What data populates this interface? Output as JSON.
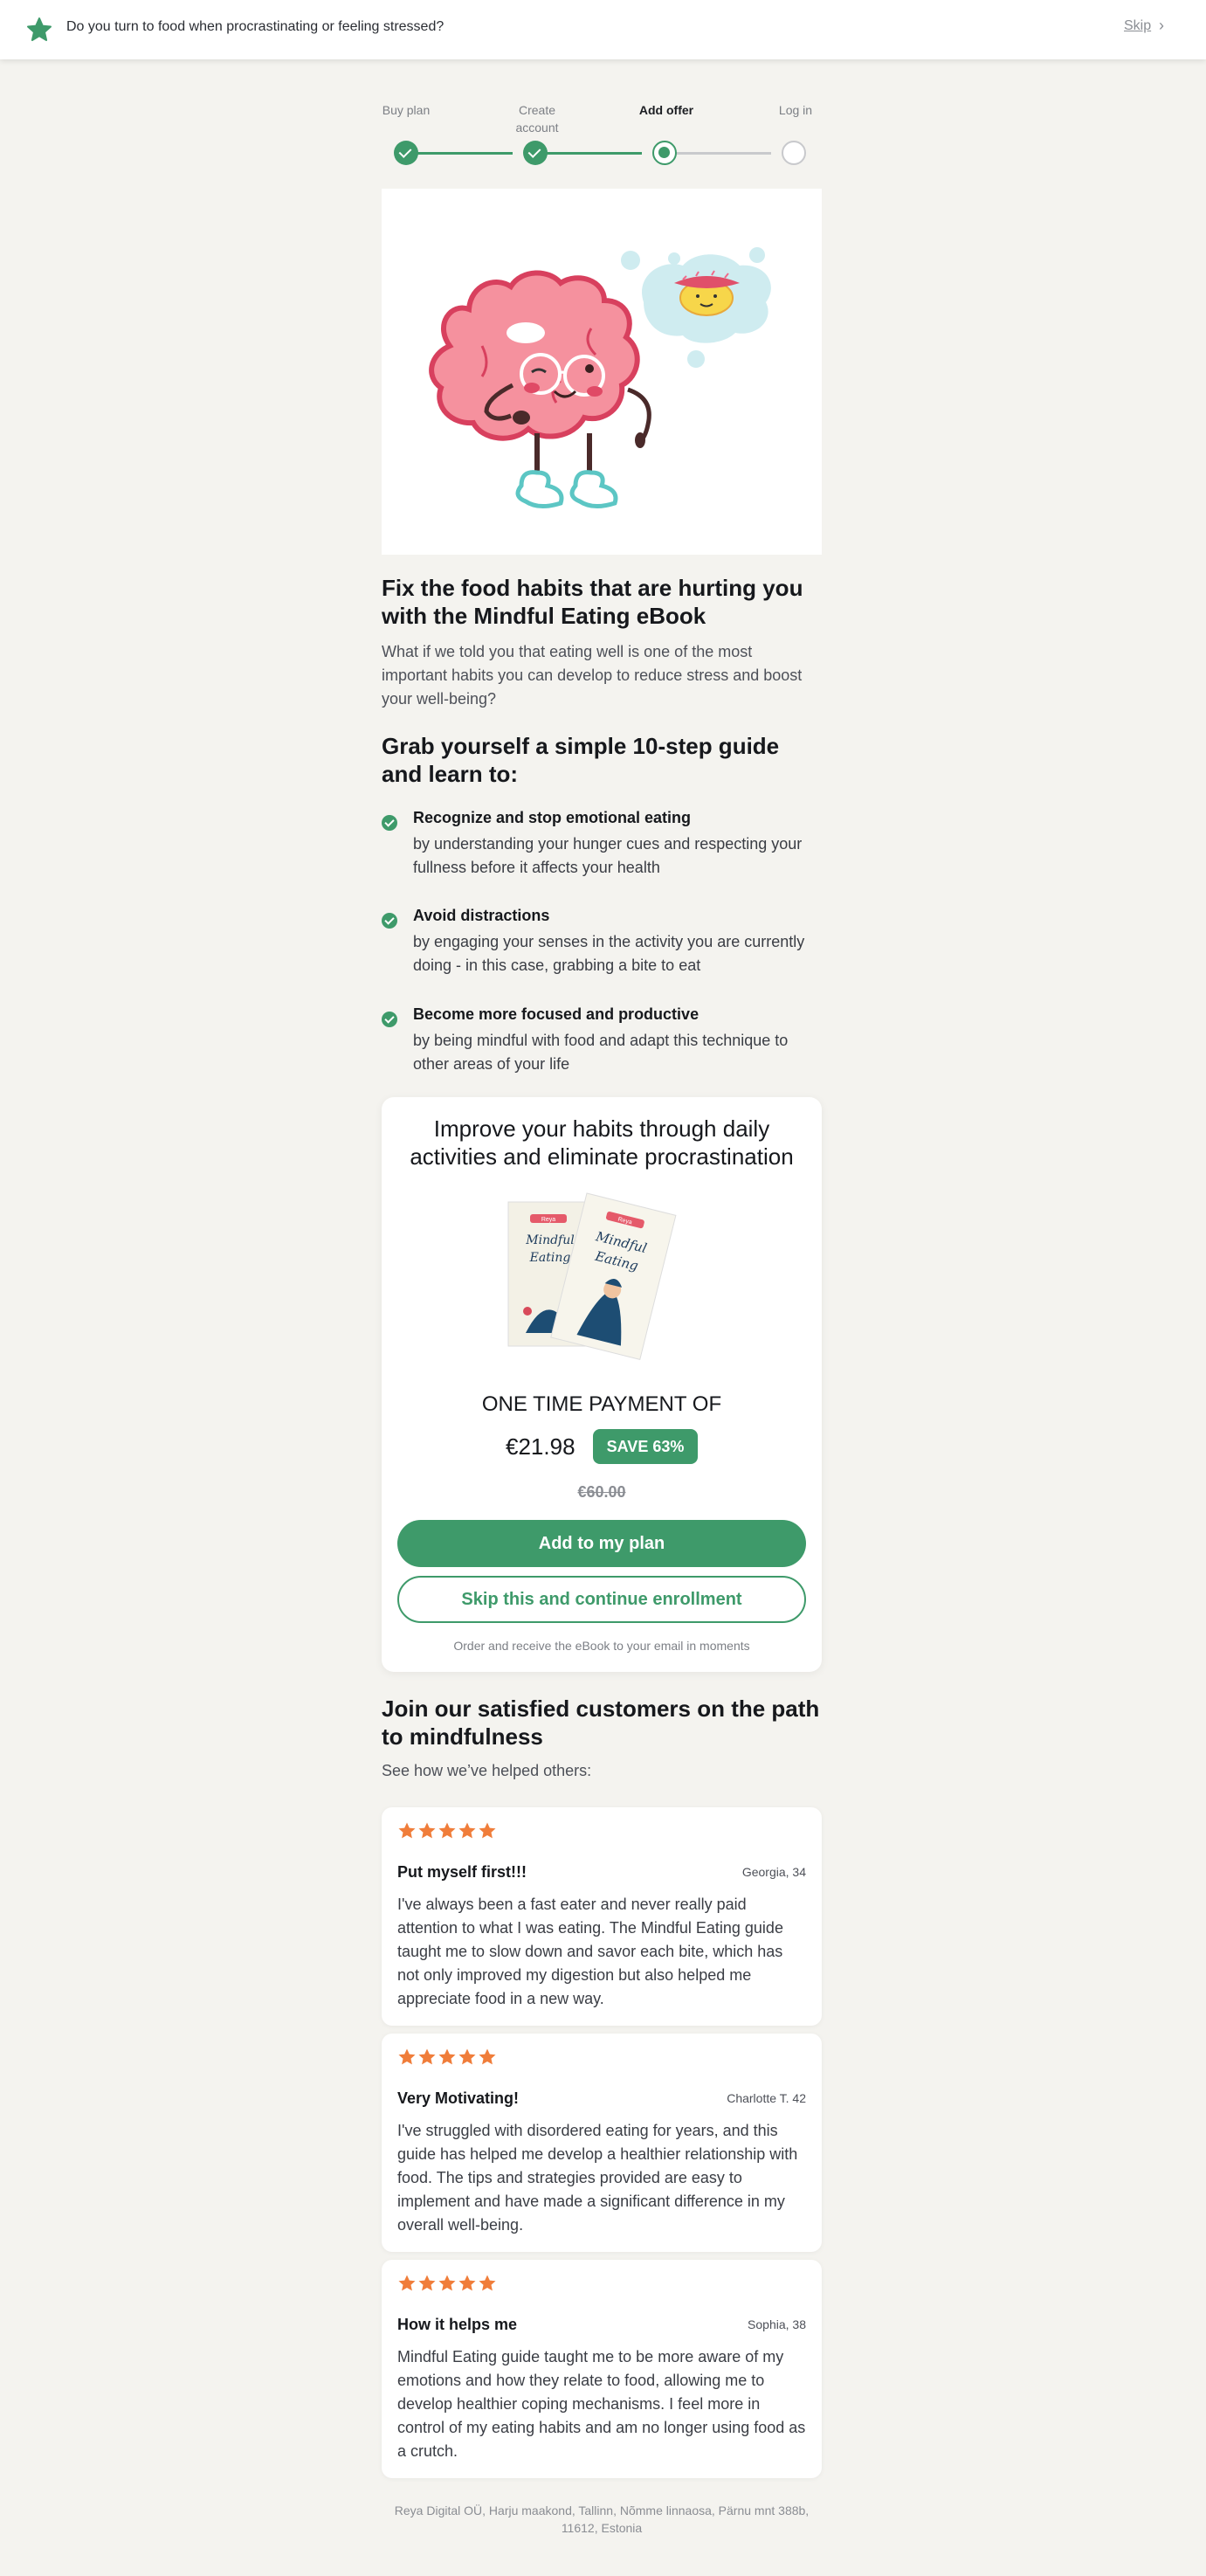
{
  "topbar": {
    "question": "Do you turn to food when procrastinating or feeling stressed?",
    "skip_label": "Skip",
    "logo_icon": "star-icon",
    "brand_color": "#3e9a6a"
  },
  "stepper": {
    "steps": [
      {
        "label": "Buy plan",
        "state": "done"
      },
      {
        "label": "Create account",
        "state": "done"
      },
      {
        "label": "Add offer",
        "state": "current"
      },
      {
        "label": "Log in",
        "state": "todo"
      }
    ]
  },
  "hero": {
    "image_icon": "brain-character-illustration"
  },
  "intro": {
    "title": "Fix the food habits that are hurting you with the Mindful Eating eBook",
    "lead": "What if we told you that eating well is one of the most important habits you can develop to reduce stress and boost your well-being?"
  },
  "guide": {
    "title": "Grab yourself a simple 10-step guide and learn to:",
    "items": [
      {
        "title": "Recognize and stop emotional eating",
        "desc": "by understanding your hunger cues and respecting your fullness before it affects your health"
      },
      {
        "title": "Avoid distractions",
        "desc": "by engaging your senses in the activity you are currently doing - in this case, grabbing a bite to eat"
      },
      {
        "title": "Become more focused and productive",
        "desc": "by being mindful with food and adapt this technique to other areas of your life"
      }
    ]
  },
  "offer": {
    "title": "Improve your habits through daily activities and eliminate procrastination",
    "book_brand": "Reya",
    "book_title_line1": "Mindful",
    "book_title_line2": "Eating",
    "payment_label": "ONE TIME PAYMENT OF",
    "price": "€21.98",
    "save_badge": "SAVE 63%",
    "old_price": "€60.00",
    "add_button": "Add to my plan",
    "skip_button": "Skip this and continue enrollment",
    "note": "Order and receive the eBook to your email in moments"
  },
  "testimonials": {
    "title": "Join our satisfied customers on the path to mindfulness",
    "subtitle": "See how we’ve helped others:",
    "star_color": "#f07d3a",
    "reviews": [
      {
        "rating": 5,
        "title": "Put myself first!!!",
        "author": "Georgia, 34",
        "body": "I've always been a fast eater and never really paid attention to what I was eating. The Mindful Eating guide taught me to slow down and savor each bite, which has not only improved my digestion but also helped me appreciate food in a new way."
      },
      {
        "rating": 5,
        "title": "Very Motivating!",
        "author": "Charlotte T. 42",
        "body": "I've struggled with disordered eating for years, and this guide has helped me develop a healthier relationship with food. The tips and strategies provided are easy to implement and have made a significant difference in my overall well-being."
      },
      {
        "rating": 5,
        "title": "How it helps me",
        "author": "Sophia, 38",
        "body": "Mindful Eating guide taught me to be more aware of my emotions and how they relate to food, allowing me to develop healthier coping mechanisms. I feel more in control of my eating habits and am no longer using food as a crutch."
      }
    ]
  },
  "footer": {
    "address": "Reya Digital OÜ, Harju maakond, Tallinn, Nõmme linnaosa, Pärnu mnt 388b, 11612, Estonia"
  }
}
